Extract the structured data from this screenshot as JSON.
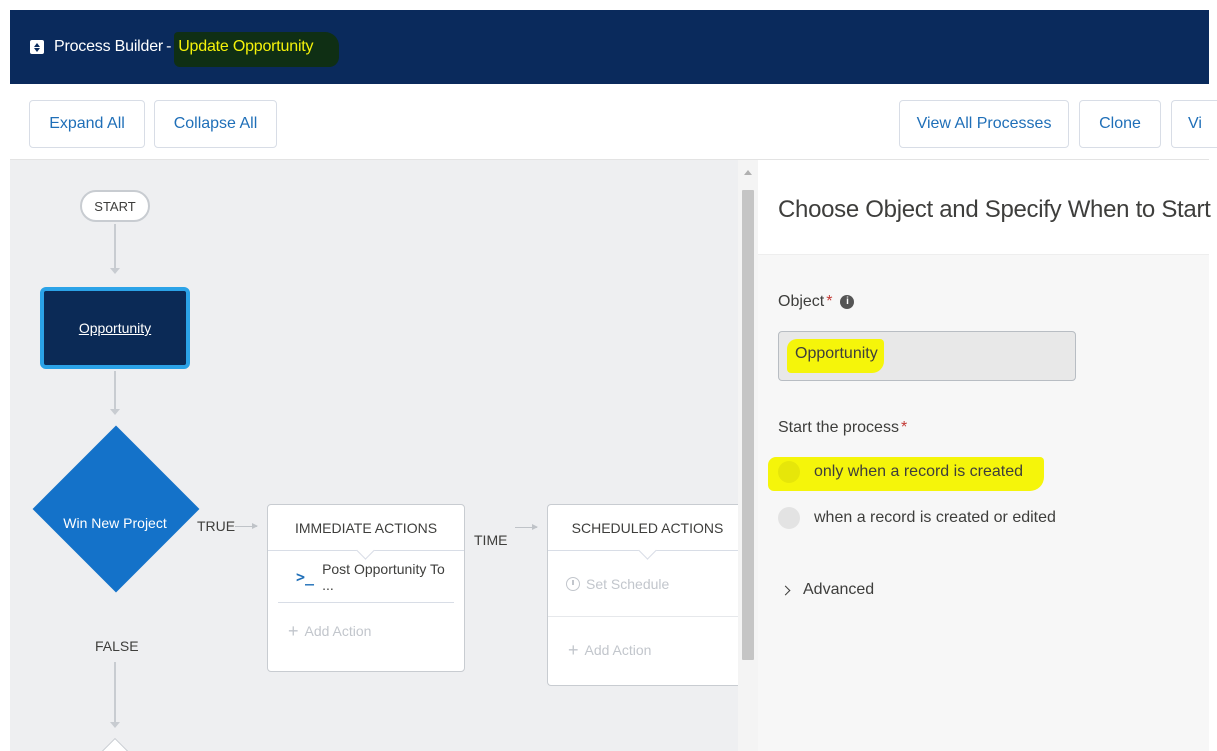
{
  "header": {
    "app_name": "Process Builder",
    "separator": "-",
    "process_name": "Update Opportunity"
  },
  "toolbar": {
    "expand_all": "Expand All",
    "collapse_all": "Collapse All",
    "view_all_processes": "View All Processes",
    "clone": "Clone",
    "view_truncated": "Vi"
  },
  "canvas": {
    "start_label": "START",
    "object_node_label": "Opportunity",
    "criteria_label": "Win New Project",
    "true_label": "TRUE",
    "false_label": "FALSE",
    "time_label": "TIME",
    "immediate": {
      "header": "IMMEDIATE ACTIONS",
      "action_label": "Post Opportunity To ...",
      "add_action": "Add Action"
    },
    "scheduled": {
      "header": "SCHEDULED ACTIONS",
      "set_schedule": "Set Schedule",
      "add_action": "Add Action"
    }
  },
  "panel": {
    "title": "Choose Object and Specify When to Start the P",
    "object_label": "Object",
    "required_mark": "*",
    "object_value": "Opportunity",
    "start_label": "Start the process",
    "option_created": "only when a record is created",
    "option_created_edited": "when a record is created or edited",
    "advanced_label": "Advanced"
  },
  "colors": {
    "header_bg": "#0a2a5c",
    "link_blue": "#1f6fb8",
    "node_dark": "#0b2a56",
    "node_border": "#2ba3e8",
    "diamond": "#1472c9",
    "highlight": "#f5f50a"
  }
}
